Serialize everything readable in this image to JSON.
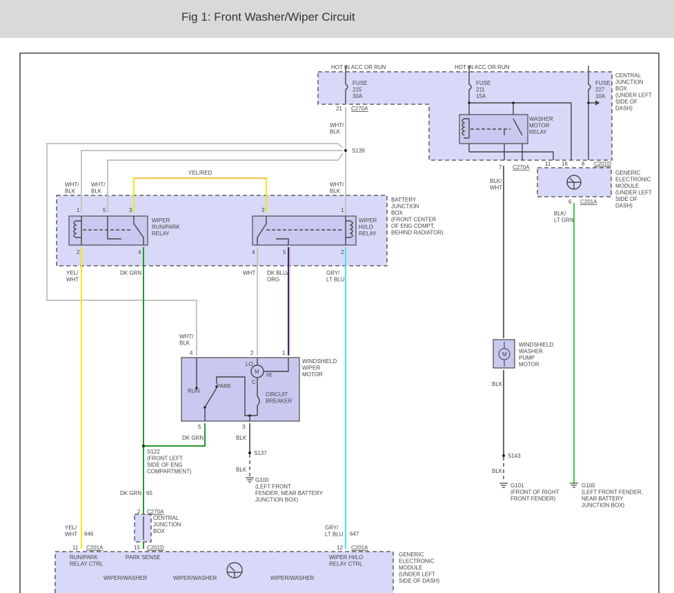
{
  "title": "Fig 1: Front Washer/Wiper Circuit",
  "power": {
    "hot1": "HOT IN ACC OR RUN",
    "hot2": "HOT IN ACC OR RUN"
  },
  "fuses": {
    "f215": [
      "FUSE",
      "215",
      "30A"
    ],
    "f211": [
      "FUSE",
      "211",
      "15A"
    ],
    "f227": [
      "FUSE",
      "227",
      "10A"
    ]
  },
  "components": {
    "cjb": [
      "CENTRAL",
      "JUNCTION",
      "BOX",
      "(UNDER LEFT",
      "SIDE OF",
      "DASH)"
    ],
    "washer_relay": [
      "WASHER",
      "MOTOR",
      "RELAY"
    ],
    "gem_top": [
      "GENERIC",
      "ELECTRONIC",
      "MODULE",
      "(UNDER LEFT",
      "SIDE OF",
      "DASH)"
    ],
    "bjb": [
      "BATTERY",
      "JUNCTION",
      "BOX",
      "(FRONT CENTER",
      "OF ENG COMPT,",
      "BEHIND RADIATOR)"
    ],
    "run_park_relay": [
      "WIPER",
      "RUN/PARK",
      "RELAY"
    ],
    "hilo_relay": [
      "WIPER",
      "HI/LO",
      "RELAY"
    ],
    "wiper_motor": [
      "WINDSHIELD",
      "WIPER",
      "MOTOR"
    ],
    "washer_pump": [
      "WINDSHIELD",
      "WASHER",
      "PUMP",
      "MOTOR"
    ],
    "cjb_small": [
      "CENTRAL",
      "JUNCTION",
      "BOX"
    ],
    "gem_bottom": [
      "GENERIC",
      "ELECTRONIC",
      "MODULE",
      "(UNDER LEFT",
      "SIDE OF DASH)"
    ]
  },
  "motor_labels": {
    "lo": "LO",
    "hi": "HI",
    "c": "C",
    "m": "M",
    "run": "RUN",
    "park": "PARK",
    "breaker": [
      "CIRCUIT",
      "BREAKER"
    ],
    "pump_m": "M"
  },
  "splices": {
    "s139": "S139",
    "s122": [
      "S122",
      "(FRONT LEFT",
      "SIDE OF ENG",
      "COMPARTMENT)"
    ],
    "s137": "S137",
    "s143": "S143"
  },
  "grounds": {
    "g100a": [
      "G100",
      "(LEFT FRONT",
      "FENDER, NEAR BATTERY",
      "JUNCTION BOX)"
    ],
    "g101": [
      "G101",
      "(FRONT OF RIGHT",
      "FRONT FENDER)"
    ],
    "g100b": [
      "G100",
      "(LEFT FRONT FENDER,",
      "NEAR BATTERY",
      "JUNCTION BOX)"
    ]
  },
  "connectors": {
    "c270a_21": "C270A",
    "c270a_7": "C270A",
    "c201d_top": "C201D",
    "c201a_6": "C201A",
    "c270a_2": "C270A",
    "c201a_11": "C201A",
    "c201d_15": "C201D",
    "c201a_12": "C201A"
  },
  "pins": {
    "p21": "21",
    "p7": "7",
    "p11t": "11",
    "p16": "16",
    "p8": "8",
    "p6": "6",
    "r1_1": "1",
    "r1_5": "5",
    "r1_3": "3",
    "r1_2": "2",
    "r1_4": "4",
    "r2_3": "3",
    "r2_1": "1",
    "r2_4": "4",
    "r2_5": "5",
    "r2_2": "2",
    "m4": "4",
    "m2": "2",
    "m1": "1",
    "m5": "5",
    "m3": "3",
    "cj2": "2",
    "g11": "11",
    "g15": "15",
    "g12": "12"
  },
  "wires": {
    "wht_blk_main": [
      "WHT/",
      "BLK"
    ],
    "wht_blk_r1": [
      "WHT/",
      "BLK"
    ],
    "wht_blk_r5": [
      "WHT/",
      "BLK"
    ],
    "wht_blk_r2": [
      "WHT/",
      "BLK"
    ],
    "yel_red": "YEL/RED",
    "yel_wht": [
      "YEL/",
      "WHT"
    ],
    "dk_grn": "DK GRN",
    "wht": "WHT",
    "dk_blu_org": [
      "DK BLU/",
      "ORG"
    ],
    "gry_lt_blu": [
      "GRY/",
      "LT BLU"
    ],
    "blk_wht": [
      "BLK/",
      "WHT"
    ],
    "blk_lt_grn": [
      "BLK/",
      "LT GRN"
    ],
    "wht_blk_motor": [
      "WHT/",
      "BLK"
    ],
    "dk_grn_motor": "DK GRN",
    "blk_motor": "BLK",
    "blk_motor2": "BLK",
    "blk_pump": "BLK",
    "blk_pump2": "BLK",
    "dk_grn_65": "DK GRN",
    "c65": "65",
    "yel_wht_646": [
      "YEL/",
      "WHT"
    ],
    "c646": "646",
    "gry_lt_blu_647": [
      "GRY/",
      "LT BLU"
    ],
    "c647": "647"
  },
  "gem_inputs": {
    "run_park": [
      "RUN/PARK",
      "RELAY CTRL"
    ],
    "park_sense": "PARK SENSE",
    "hilo": [
      "WIPER HI/LO",
      "RELAY CTRL"
    ],
    "ww1": "WIPER/WASHER",
    "ww2": "WIPER/WASHER",
    "ww3": "WIPER/WASHER"
  },
  "colors": {
    "yellow": "#f2ea10",
    "dk_green": "#2a942a",
    "lt_green": "#46c846",
    "blue": "#1c2aa0",
    "cyan": "#40e4f4",
    "box_fill": "#d8d8f8"
  }
}
